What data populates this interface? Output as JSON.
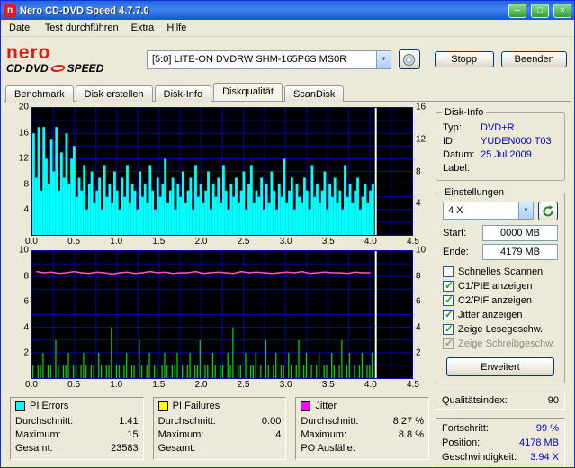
{
  "window": {
    "title": "Nero CD-DVD Speed 4.7.7.0"
  },
  "menu": {
    "items": [
      "Datei",
      "Test durchführen",
      "Extra",
      "Hilfe"
    ]
  },
  "logo": {
    "name": "nero",
    "product_a": "CD·DVD",
    "product_b": "SPEED"
  },
  "toolbar": {
    "drive": "[5:0]  LITE-ON DVDRW SHM-165P6S MS0R",
    "stop_label": "Stopp",
    "quit_label": "Beenden"
  },
  "tabs": [
    {
      "label": "Benchmark"
    },
    {
      "label": "Disk erstellen"
    },
    {
      "label": "Disk-Info"
    },
    {
      "label": "Diskqualität",
      "active": true
    },
    {
      "label": "ScanDisk"
    }
  ],
  "disk_info": {
    "title": "Disk-Info",
    "rows": [
      {
        "label": "Typ:",
        "value": "DVD+R"
      },
      {
        "label": "ID:",
        "value": "YUDEN000 T03"
      },
      {
        "label": "Datum:",
        "value": "25 Jul 2009"
      },
      {
        "label": "Label:",
        "value": ""
      }
    ]
  },
  "settings": {
    "title": "Einstellungen",
    "speed": "4 X",
    "start_label": "Start:",
    "start_value": "0000 MB",
    "end_label": "Ende:",
    "end_value": "4179 MB",
    "advanced_label": "Erweitert",
    "checkboxes": [
      {
        "label": "Schnelles Scannen",
        "checked": false,
        "enabled": true
      },
      {
        "label": "C1/PIE anzeigen",
        "checked": true,
        "enabled": true
      },
      {
        "label": "C2/PIF anzeigen",
        "checked": true,
        "enabled": true
      },
      {
        "label": "Jitter anzeigen",
        "checked": true,
        "enabled": true
      },
      {
        "label": "Zeige Lesegeschw.",
        "checked": true,
        "enabled": true
      },
      {
        "label": "Zeige Schreibgeschw.",
        "checked": true,
        "enabled": false
      }
    ]
  },
  "quality": {
    "label": "Qualitätsindex:",
    "value": "90"
  },
  "progress": {
    "rows": [
      {
        "label": "Fortschritt:",
        "value": "99 %"
      },
      {
        "label": "Position:",
        "value": "4178 MB"
      },
      {
        "label": "Geschwindigkeit:",
        "value": "3.94 X"
      }
    ]
  },
  "stats": [
    {
      "name": "PI Errors",
      "color": "#00ffff",
      "rows": [
        {
          "label": "Durchschnitt:",
          "value": "1.41"
        },
        {
          "label": "Maximum:",
          "value": "15"
        },
        {
          "label": "Gesamt:",
          "value": "23583"
        }
      ]
    },
    {
      "name": "PI Failures",
      "color": "#ffff00",
      "rows": [
        {
          "label": "Durchschnitt:",
          "value": "0.00"
        },
        {
          "label": "Maximum:",
          "value": "4"
        },
        {
          "label": "Gesamt:",
          "value": ""
        }
      ]
    },
    {
      "name": "Jitter",
      "color": "#ff00ff",
      "rows": [
        {
          "label": "Durchschnitt:",
          "value": "8.27 %"
        },
        {
          "label": "Maximum:",
          "value": "8.8 %"
        },
        {
          "label": "PO Ausfälle:",
          "value": ""
        }
      ]
    }
  ],
  "chart_data": [
    {
      "type": "area",
      "title": "PI Errors vs position (GB)",
      "xlim": [
        0,
        4.5
      ],
      "ylim": [
        0,
        20
      ],
      "ylim_right": [
        0,
        16
      ],
      "x_tick_labels": [
        "0.0",
        "0.5",
        "1.0",
        "1.5",
        "2.0",
        "2.5",
        "3.0",
        "3.5",
        "4.0",
        "4.5"
      ],
      "y_ticks_left": [
        20,
        16,
        12,
        8,
        4
      ],
      "y_ticks_right": [
        16,
        12,
        8,
        4
      ],
      "grid": {
        "x_step": 0.25,
        "y_step": 2,
        "color": "#0000b4"
      },
      "bg": "#000000",
      "data_x_end": 4.05,
      "cursor_x": 4.07,
      "cursor_color": "#ffffff",
      "series": [
        {
          "name": "PI Errors",
          "kind": "bars",
          "color": "#00ffff",
          "bar_fill": 1,
          "values": [
            16,
            9,
            17,
            7,
            17,
            12,
            8,
            15,
            10,
            17,
            7,
            13,
            9,
            16,
            8,
            12,
            14,
            6,
            9,
            7,
            11,
            4,
            8,
            10,
            5,
            7,
            9,
            4,
            11,
            6,
            8,
            5,
            10,
            7,
            4,
            9,
            6,
            11,
            5,
            8,
            7,
            4,
            10,
            6,
            8,
            5,
            11,
            7,
            4,
            9,
            6,
            8,
            12,
            5,
            7,
            9,
            4,
            8,
            6,
            10,
            5,
            7,
            9,
            4,
            11,
            6,
            8,
            5,
            7,
            10,
            4,
            8,
            6,
            9,
            5,
            11,
            7,
            4,
            8,
            6,
            9,
            5,
            7,
            10,
            4,
            8,
            11,
            5,
            7,
            6,
            9,
            4,
            8,
            5,
            10,
            7,
            4,
            8,
            6,
            12,
            5,
            7,
            9,
            4,
            8,
            6,
            5,
            9,
            7,
            4,
            11,
            6,
            8,
            5,
            7,
            10,
            4,
            8,
            6,
            9,
            5,
            7,
            4,
            11,
            6,
            8,
            5,
            7,
            9,
            4,
            6,
            8,
            5,
            7,
            8
          ]
        }
      ]
    },
    {
      "type": "bar+line",
      "title": "PI Failures and Jitter vs position (GB)",
      "xlim": [
        0,
        4.5
      ],
      "ylim": [
        0,
        10
      ],
      "ylim_right": [
        0,
        10
      ],
      "x_tick_labels": [
        "0.0",
        "0.5",
        "1.0",
        "1.5",
        "2.0",
        "2.5",
        "3.0",
        "3.5",
        "4.0",
        "4.5"
      ],
      "y_ticks_left": [
        10,
        8,
        6,
        4,
        2
      ],
      "y_ticks_right": [
        10,
        8,
        6,
        4,
        2
      ],
      "grid": {
        "x_step": 0.25,
        "y_step": 1,
        "color": "#0000b4"
      },
      "bg": "#000000",
      "data_x_end": 4.05,
      "cursor_x": 4.07,
      "cursor_color": "#ffffff",
      "series": [
        {
          "name": "PI Failures",
          "kind": "bars",
          "color": "#00d800",
          "bar_fill": 0.45,
          "values": [
            1,
            0,
            1,
            1,
            2,
            0,
            1,
            1,
            0,
            3,
            1,
            0,
            1,
            1,
            2,
            0,
            1,
            1,
            0,
            1,
            2,
            1,
            0,
            1,
            1,
            0,
            2,
            1,
            0,
            1,
            1,
            4,
            0,
            1,
            1,
            0,
            1,
            2,
            0,
            1,
            1,
            0,
            3,
            1,
            0,
            1,
            2,
            0,
            1,
            1,
            0,
            1,
            2,
            1,
            0,
            1,
            1,
            2,
            0,
            1,
            0,
            1,
            2,
            0,
            1,
            1,
            3,
            0,
            1,
            1,
            0,
            2,
            1,
            0,
            1,
            1,
            0,
            2,
            1,
            4,
            0,
            1,
            1,
            0,
            2,
            0,
            1,
            1,
            2,
            0,
            1,
            0,
            3,
            1,
            0,
            1,
            2,
            0,
            1,
            1,
            0,
            2,
            1,
            0,
            1,
            3,
            0,
            1,
            2,
            0,
            1,
            0,
            1,
            2,
            0,
            1,
            1,
            0,
            2,
            1,
            0,
            1,
            3,
            0,
            1,
            2,
            0,
            1,
            0,
            1,
            2,
            0,
            1,
            1,
            2
          ]
        },
        {
          "name": "Jitter",
          "kind": "line",
          "color": "#ff55cc",
          "values": [
            8.4,
            8.3,
            8.35,
            8.25,
            8.3,
            8.4,
            8.3,
            8.25,
            8.35,
            8.3,
            8.2,
            8.3,
            8.35,
            8.25,
            8.3,
            8.4,
            8.3,
            8.35,
            8.25,
            8.3,
            8.3,
            8.4,
            8.25,
            8.3,
            8.35,
            8.3,
            8.25,
            8.4,
            8.3,
            8.35,
            8.3,
            8.25,
            8.3,
            8.35,
            8.3,
            8.4,
            8.25,
            8.3,
            8.35,
            8.3,
            8.3,
            8.25,
            8.35,
            8.3,
            8.3
          ]
        }
      ]
    }
  ]
}
